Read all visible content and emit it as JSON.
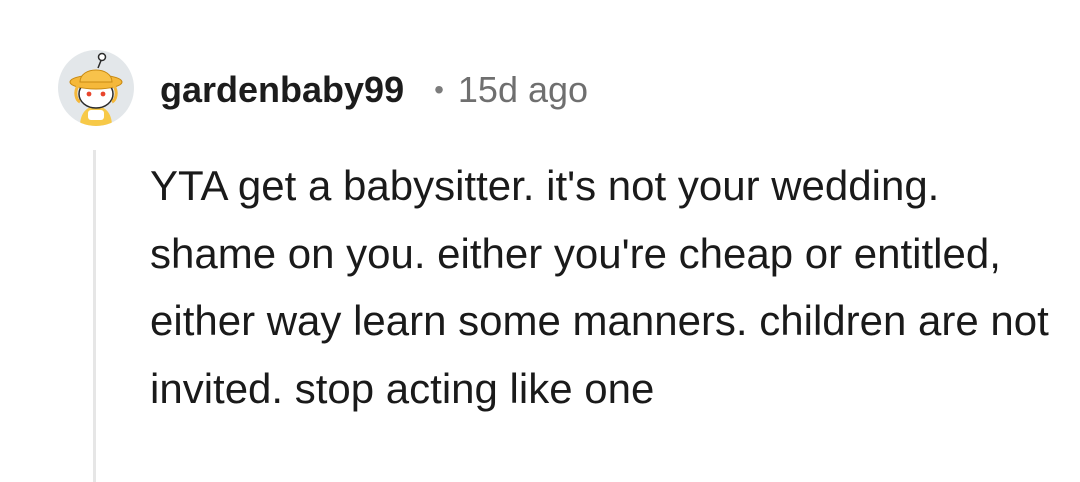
{
  "comment": {
    "author": "gardenbaby99",
    "separator": "•",
    "timestamp": "15d ago",
    "body": "YTA get a babysitter. it's not your wedding. shame on you. either you're cheap or entitled, either way learn some manners. children are not invited. stop acting like one",
    "avatar_icon": "snoo-avatar-yellow-hat-icon"
  },
  "colors": {
    "avatar_background": "#e3e7ea",
    "hat": "#f5b83a",
    "thread_line": "#e6e6e6",
    "timestamp": "#6f6f6f"
  }
}
